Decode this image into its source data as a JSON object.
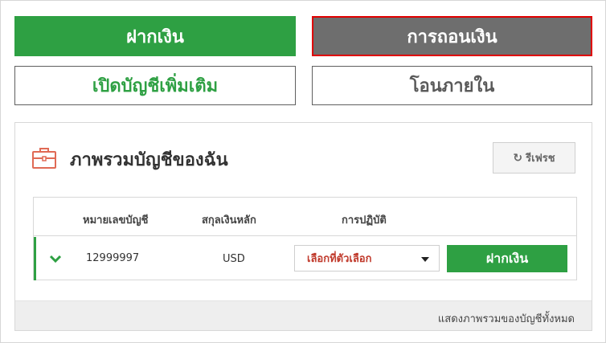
{
  "top_buttons": {
    "deposit": "ฝากเงิน",
    "withdraw": "การถอนเงิน",
    "open_account": "เปิดบัญชีเพิ่มเติม",
    "internal_transfer": "โอนภายใน"
  },
  "panel": {
    "icon": "briefcase-icon",
    "title": "ภาพรวมบัญชีของฉัน",
    "refresh_icon": "refresh-icon",
    "refresh_label": "รีเฟรช",
    "table": {
      "headers": {
        "account_number": "หมายเลขบัญชี",
        "base_currency": "สกุลเงินหลัก",
        "actions": "การปฏิบัติ"
      },
      "rows": [
        {
          "expand_icon": "chevron-down-icon",
          "account_number": "12999997",
          "currency": "USD",
          "select_value": "เลือกที่ตัวเลือก",
          "deposit_label": "ฝากเงิน"
        }
      ]
    },
    "footer_link": "แสดงภาพรวมของบัญชีทั้งหมด"
  },
  "colors": {
    "accent_green": "#2ea043",
    "withdraw_gray": "#6e6e6e",
    "highlight_red": "#e00000",
    "select_text_red": "#c0392b"
  }
}
